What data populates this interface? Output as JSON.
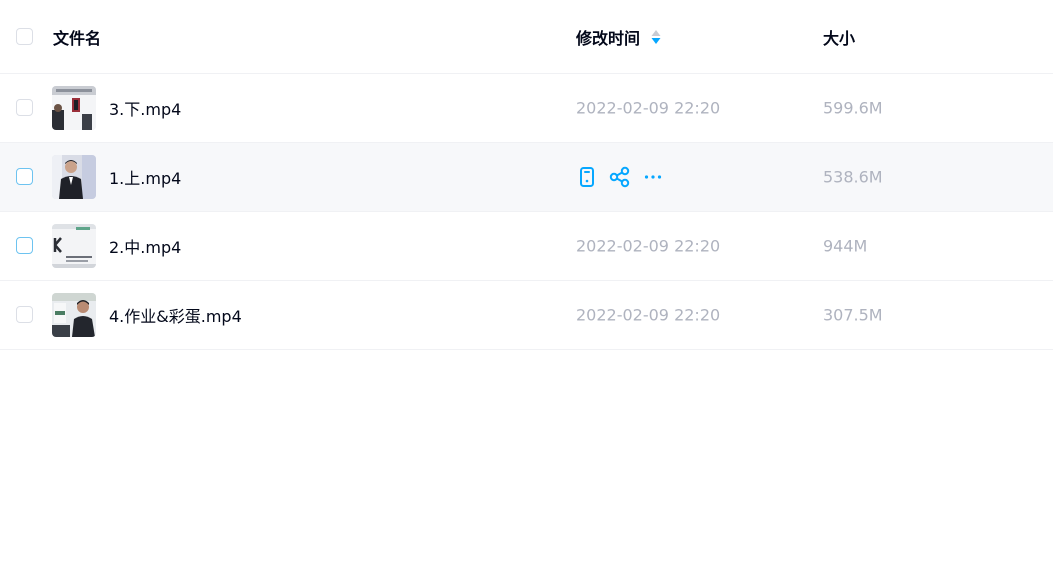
{
  "header": {
    "name_label": "文件名",
    "time_label": "修改时间",
    "size_label": "大小"
  },
  "files": [
    {
      "name": "3.下.mp4",
      "time": "2022-02-09 22:20",
      "size": "599.6M"
    },
    {
      "name": "1.上.mp4",
      "time": "",
      "size": "538.6M"
    },
    {
      "name": "2.中.mp4",
      "time": "2022-02-09 22:20",
      "size": "944M"
    },
    {
      "name": "4.作业&彩蛋.mp4",
      "time": "2022-02-09 22:20",
      "size": "307.5M"
    }
  ],
  "colors": {
    "accent": "#06a7ff",
    "text_primary": "#03081a",
    "text_secondary": "#afb3bf",
    "hover_row": "#f7f8fa"
  },
  "icons": {
    "sort": "sort-descending-icon",
    "hover_actions": [
      "mobile-icon",
      "share-icon",
      "more-icon"
    ]
  }
}
